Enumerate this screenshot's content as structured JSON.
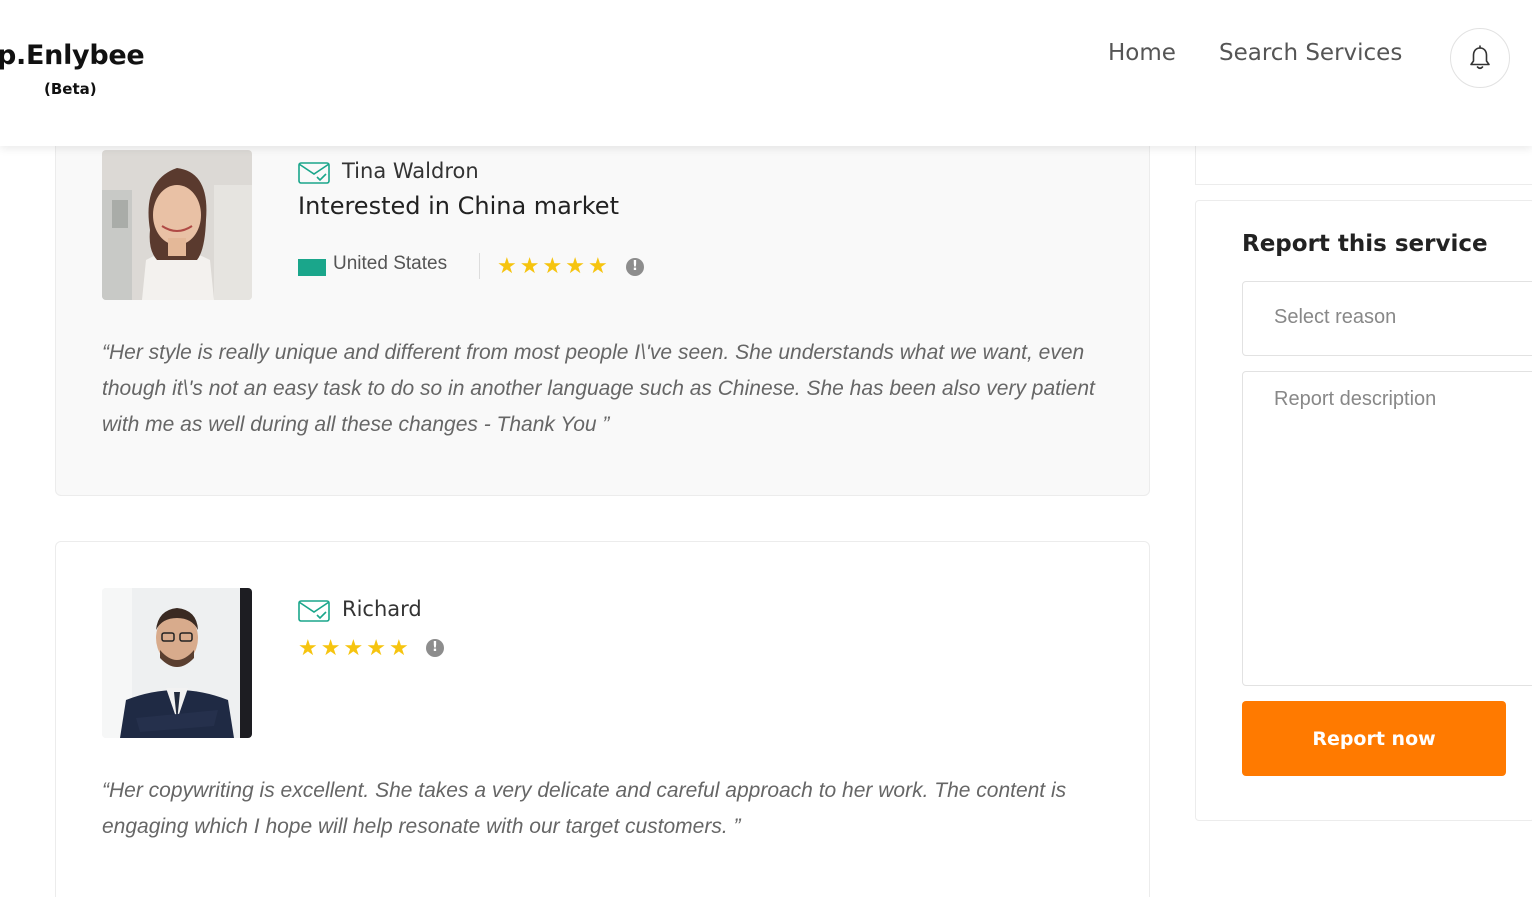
{
  "header": {
    "logo_name": "pp.Enlybee",
    "logo_beta": "(Beta)",
    "nav": {
      "home": "Home",
      "search": "Search Services"
    },
    "bell_icon": "bell-icon"
  },
  "reviews": [
    {
      "name": "Tina Waldron",
      "title": "Interested in China market",
      "country": "United States",
      "flag_color": "#1aa68b",
      "rating": 5,
      "star_glyph": "★",
      "info_glyph": "!",
      "quote": "“Her style is really unique and different from most people I\\'ve seen. She understands what we want, even though it\\'s not an easy task to do so in another language such as Chinese. She has been also very patient with me as well during all these changes - Thank You ”"
    },
    {
      "name": "Richard",
      "rating": 5,
      "star_glyph": "★",
      "info_glyph": "!",
      "quote": "“Her copywriting is excellent. She takes a very delicate and careful approach to her work. The content is engaging which I hope will help resonate with our target customers. ”"
    }
  ],
  "report": {
    "title": "Report this service",
    "select_placeholder": "Select reason",
    "description_placeholder": "Report description",
    "button_label": "Report now"
  },
  "colors": {
    "accent": "#ff7a00",
    "star": "#f6c40f",
    "mail_icon": "#1aa68b"
  }
}
